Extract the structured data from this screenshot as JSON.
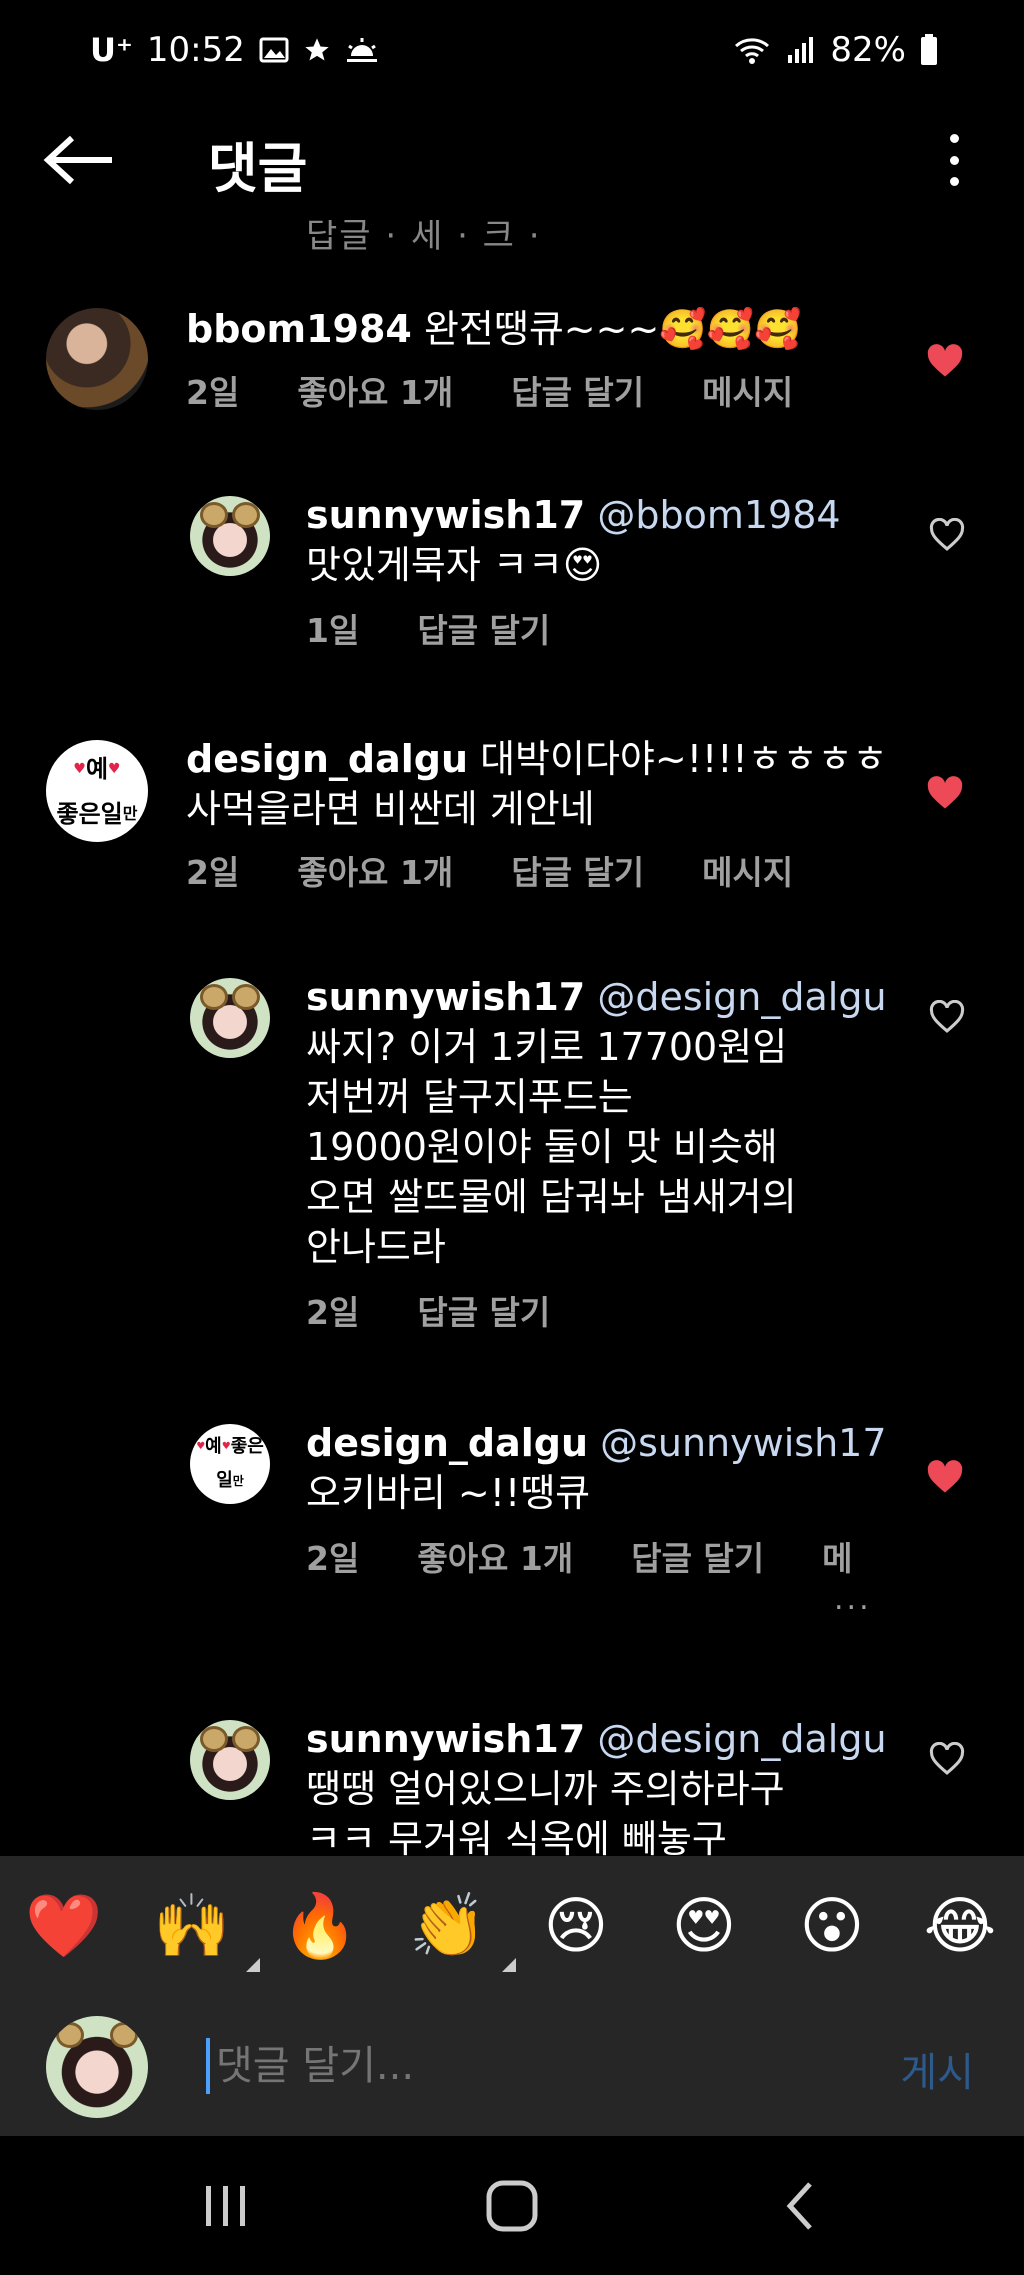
{
  "status_bar": {
    "carrier": "U⁺",
    "time": "10:52",
    "battery": "82%"
  },
  "header": {
    "title": "댓글"
  },
  "cut_text": "답글 · 세 · 크 ·",
  "comments": [
    {
      "username": "bbom1984",
      "lines": [
        "완전땡큐~~~🥰🥰🥰"
      ],
      "time": "2일",
      "likes": "좋아요 1개",
      "reply": "답글 달기",
      "message": "메시지",
      "liked": true
    },
    {
      "username": "sunnywish17",
      "mention": "@bbom1984",
      "lines": [
        "맛있게묵자 ㅋㅋ😍"
      ],
      "time": "1일",
      "reply": "답글 달기",
      "liked": false
    },
    {
      "username": "design_dalgu",
      "lines": [
        "대박이다야~!!!!ㅎㅎㅎㅎ",
        "사먹을라면 비싼데 게안네"
      ],
      "time": "2일",
      "likes": "좋아요 1개",
      "reply": "답글 달기",
      "message": "메시지",
      "liked": true
    },
    {
      "username": "sunnywish17",
      "mention": "@design_dalgu",
      "lines": [
        "싸지? 이거 1키로 17700원임",
        "저번꺼 달구지푸드는",
        "19000원이야 둘이 맛 비슷해",
        "오면 쌀뜨물에 담궈놔 냄새거의",
        "안나드라"
      ],
      "time": "2일",
      "reply": "답글 달기",
      "liked": false
    },
    {
      "username": "design_dalgu",
      "mention": "@sunnywish17",
      "lines": [
        "오키바리 ~!!땡큐"
      ],
      "time": "2일",
      "likes": "좋아요 1개",
      "reply": "답글 달기",
      "message": "메",
      "more": "...",
      "liked": true
    },
    {
      "username": "sunnywish17",
      "mention": "@design_dalgu",
      "lines": [
        "땡땡 얼어있으니까 주의하라구",
        "ㅋㅋ 무거워 식옥에 빼놓구"
      ],
      "liked": false
    }
  ],
  "emoji_bar": [
    "❤️",
    "🙌",
    "🔥",
    "👏",
    "😢",
    "😍",
    "😮",
    "😂"
  ],
  "composer": {
    "placeholder": "댓글 달기...",
    "post_label": "게시"
  },
  "avatar_labels": {
    "dalgu": [
      "예",
      "좋은",
      "일",
      "만"
    ]
  },
  "colors": {
    "like_red": "#ed4956",
    "background": "#000000",
    "bar": "#262626",
    "post_blue": "#2d5a8a"
  }
}
